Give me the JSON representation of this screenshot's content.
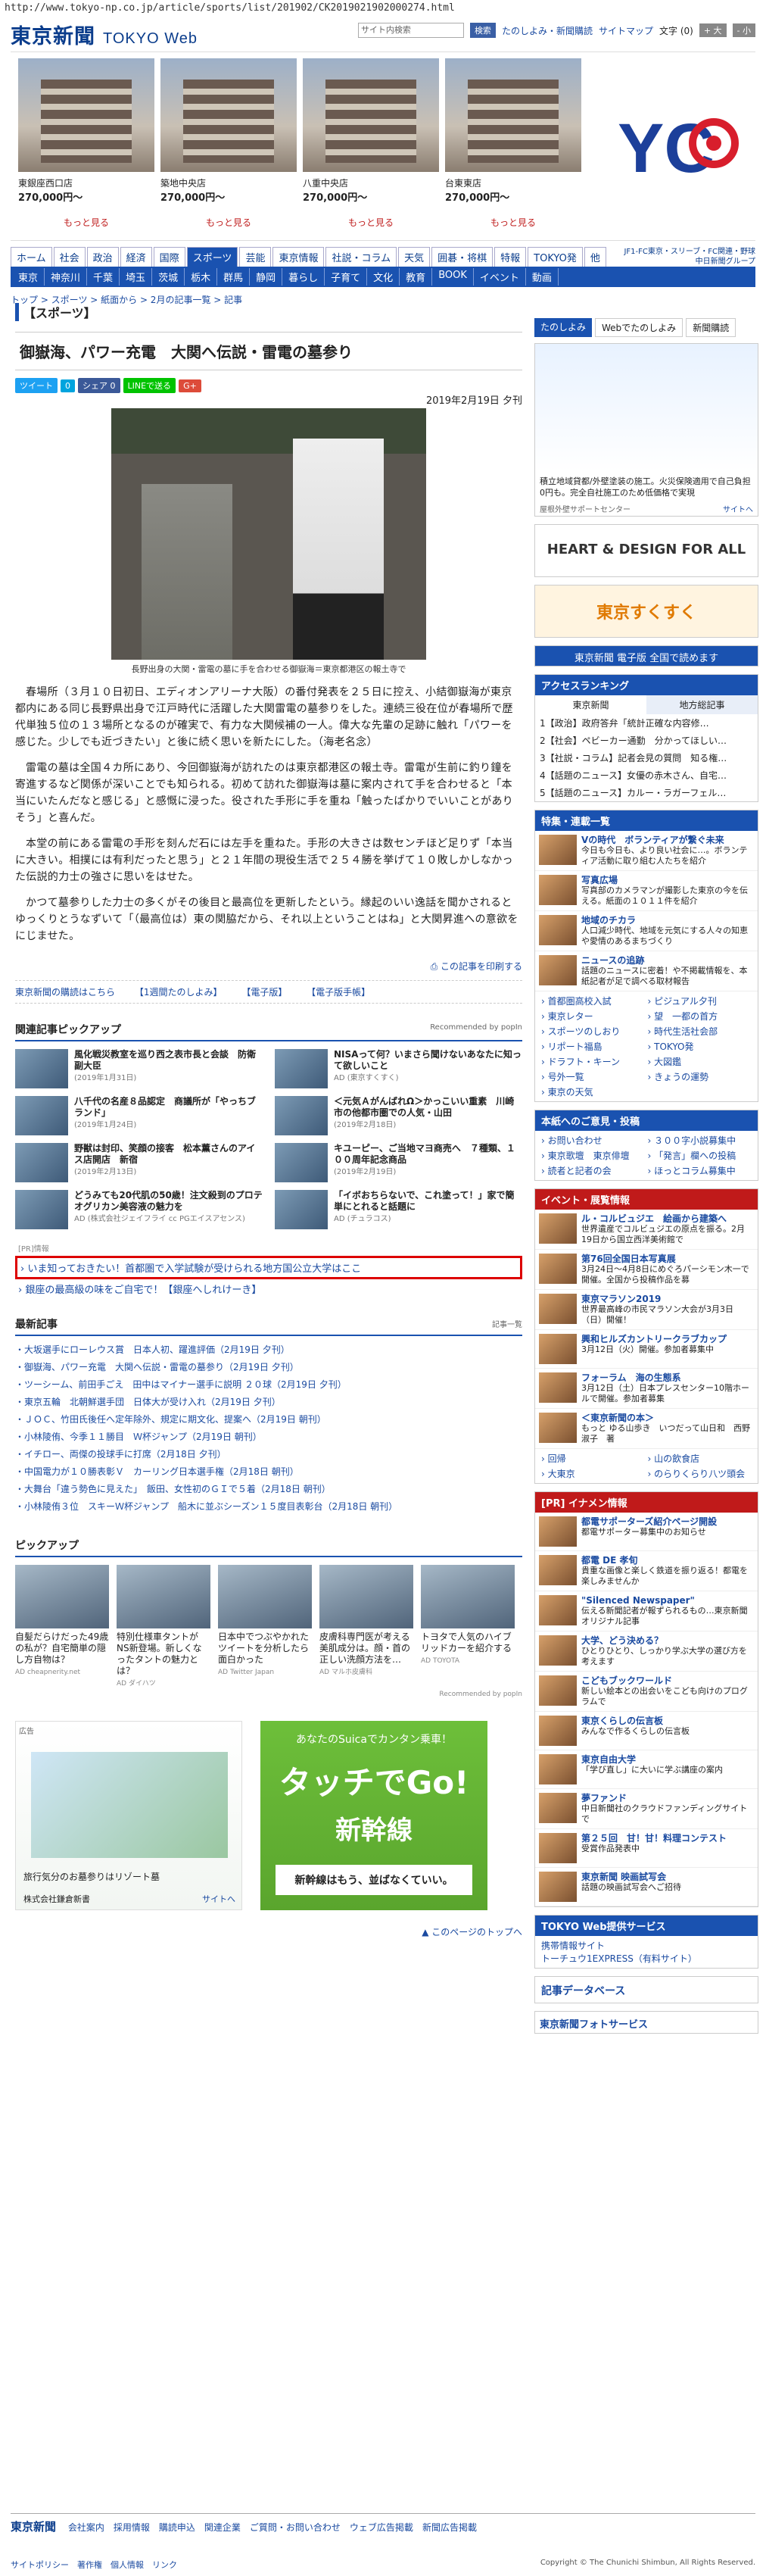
{
  "url": "http://www.tokyo-np.co.jp/article/sports/list/201902/CK2019021902000274.html",
  "logo": {
    "name": "東京新聞",
    "web": "TOKYO Web"
  },
  "header": {
    "search_placeholder": "サイト内検索",
    "search_btn": "検索",
    "links": [
      "たのしよみ・新聞購読",
      "サイトマップ"
    ],
    "font_label": "文字",
    "font_size": "(0)",
    "plus": "+ 大",
    "minus": "- 小"
  },
  "props": [
    {
      "name": "東銀座西口店",
      "price": "270,000円〜",
      "more": "もっと見る"
    },
    {
      "name": "築地中央店",
      "price": "270,000円〜",
      "more": "もっと見る"
    },
    {
      "name": "八重中央店",
      "price": "270,000円〜",
      "more": "もっと見る"
    },
    {
      "name": "台東東店",
      "price": "270,000円〜",
      "more": "もっと見る"
    }
  ],
  "ad_logo": "YC",
  "nav1": [
    "ホーム",
    "社会",
    "政治",
    "経済",
    "国際",
    "スポーツ",
    "芸能",
    "東京情報",
    "社説・コラム",
    "天気",
    "囲碁・将棋",
    "特報",
    "TOKYO発",
    "他"
  ],
  "nav2": [
    "東京",
    "神奈川",
    "千葉",
    "埼玉",
    "茨城",
    "栃木",
    "群馬",
    "静岡",
    "暮らし",
    "子育て",
    "文化",
    "教育",
    "BOOK",
    "イベント",
    "動画"
  ],
  "nav_right": [
    "JF1-FC東京・スリーブ・FC関連・野球",
    "中日新聞グループ"
  ],
  "crumb": "トップ > スポーツ > 紙面から > 2月の記事一覧 > 記事",
  "category": "【スポーツ】",
  "title": "御嶽海、パワー充電　大関へ伝説・雷電の墓参り",
  "share": [
    "ツイート",
    "0",
    "シェア 0",
    "LINEで送る",
    "G+"
  ],
  "date": "2019年2月19日 夕刊",
  "caption": "長野出身の大関・雷電の墓に手を合わせる御嶽海＝東京都港区の報土寺で",
  "paragraphs": [
    "春場所（３月１０日初日、エディオンアリーナ大阪）の番付発表を２５日に控え、小結御嶽海が東京都内にある同じ長野県出身で江戸時代に活躍した大関雷電の墓参りをした。連続三役在位が春場所で歴代単独５位の１３場所となるのが確実で、有力な大関候補の一人。偉大な先輩の足跡に触れ「パワーを感じた。少しでも近づきたい」と後に続く思いを新たにした。（海老名念）",
    "雷電の墓は全国４カ所にあり、今回御嶽海が訪れたのは東京都港区の報土寺。雷電が生前に釣り鐘を寄進するなど関係が深いことでも知られる。初めて訪れた御嶽海は墓に案内されて手を合わせると「本当にいたんだなと感じる」と感慨に浸った。役された手形に手を重ね「触ったばかりでいいことがありそう」と喜んだ。",
    "本堂の前にある雷電の手形を刻んだ石には左手を重ねた。手形の大きさは数センチほど足りず「本当に大きい。相撲には有利だったと思う」と２１年間の現役生活で２５４勝を挙げて１０敗しかしなかった伝説的力士の強さに思いをはせた。",
    "かつて墓参りした力士の多くがその後目と最高位を更新したという。縁起のいい逸話を聞かされるとゆっくりとうなずいて「（最高位は）東の関脇だから、それ以上ということはね」と大関昇進への意欲をにじませた。"
  ],
  "print": "この記事を印刷する",
  "links": [
    "東京新聞の購読はこちら",
    "【1週間たのしよみ】",
    "【電子版】",
    "【電子版手帳】"
  ],
  "related_hd": "関連記事ピックアップ",
  "related_sub": "Recommended by popIn",
  "related": [
    {
      "t": "風化戦災教室を巡り西之表市長と会談　防衛副大臣",
      "d": "(2019年1月31日)"
    },
    {
      "t": "NISAって何？いまさら聞けないあなたに知って欲しいこと",
      "d": "AD (東京すくすく)"
    },
    {
      "t": "八千代の名産８品認定　商議所が「やっちブランド」",
      "d": "(2019年1月24日)"
    },
    {
      "t": "＜元気ＡがんばれΩ＞かっこいい重素　川崎市の他都市圏での人気・山田",
      "d": "(2019年2月18日)"
    },
    {
      "t": "野獣は封印、笑顔の接客　松本薫さんのアイス店開店　新宿",
      "d": "(2019年2月13日)"
    },
    {
      "t": "キユーピー、ご当地マヨ商売へ　７種類、１００周年記念商品",
      "d": "(2019年2月19日)"
    },
    {
      "t": "どうみても20代肌の50歳！注文殺到のプロテオグリカン美容液の魅力を",
      "d": "AD (株式会社ジェイフライ cc PGエイスアセンス)"
    },
    {
      "t": "「イボおちらないで、これ塗って！」家で簡単にとれると話題に",
      "d": "AD (チュラコス)"
    }
  ],
  "pr_label": "[PR]情報",
  "pr_items": [
    "いま知っておきたい！首都圏で入学試験が受けられる地方国公立大学はここ",
    "銀座の最高級の味をご自宅で！【銀座へしれけーき】"
  ],
  "latest_hd": "最新記事",
  "latest_sub": "記事一覧",
  "latest": [
    "大坂選手にローレウス賞　日本人初、躍進評価（2月19日 夕刊）",
    "御嶽海、パワー充電　大関へ伝説・雷電の墓参り（2月19日 夕刊）",
    "ツーシーム、前田手ごえ　田中はマイナー選手に説明 ２０球（2月19日 夕刊）",
    "東京五輪　北朝鮮選手団　日体大が受け入れ（2月19日 夕刊）",
    "ＪＯＣ、竹田氏後任へ定年除外、規定に期文化、提案へ（2月19日 朝刊）",
    "小林陵侑、今季１１勝目　Ｗ杯ジャンプ（2月19日 朝刊）",
    "イチロー、両傑の投球手に打席（2月18日 夕刊）",
    "中国電力が１０勝表彰Ｖ　カーリング日本選手権（2月18日 朝刊）",
    "大舞台「違う勢色に見えた」　飯田、女性初のＧＩで５着（2月18日 朝刊）",
    "小林陵侑３位　スキーＷ杯ジャンプ　船木に並ぶシーズン１５度目表彰台（2月18日 朝刊）"
  ],
  "pickup_hd": "ピックアップ",
  "pickup": [
    {
      "t": "自髪だらけだった49歳の私が？自宅簡単の隠し方自物は？",
      "s": "AD cheapnerity.net"
    },
    {
      "t": "特別仕様車タントがNS新登場。新しくなったタントの魅力とは？",
      "s": "AD ダイハツ"
    },
    {
      "t": "日本中でつぶやかれたツイートを分析したら面白かった",
      "s": "AD Twitter Japan"
    },
    {
      "t": "皮膚科専門医が考える美肌成分は。顔・首の正しい洗顔方法を…",
      "s": "AD マルホ皮膚科"
    },
    {
      "t": "トヨタで人気のハイブリッドカーを紹介する",
      "s": "AD TOYOTA"
    }
  ],
  "pickup_sub": "Recommended by popIn",
  "ad1": {
    "label": "広告",
    "text": "旅行気分のお墓参りはリゾート墓",
    "sponsor": "株式会社鎌倉新書",
    "site": "サイトへ"
  },
  "ad2": {
    "t1": "あなたのSuicaでカンタン乗車！",
    "t2": "タッチでGo!",
    "t3": "新幹線",
    "t4": "新幹線はもう、並ばなくていい。"
  },
  "totop": "このページのトップへ",
  "side": {
    "tabs": [
      "たのしよみ",
      "Webでたのしよみ",
      "新聞購読"
    ],
    "adtxt": "積立地域貸都/外壁塗装の施工。火災保険適用で自己負担0円も。完全自社施工のため低価格で実現",
    "adsrc": "屋根外壁サポートセンター",
    "adsite": "サイトへ",
    "heart": "HEART & DESIGN FOR ALL",
    "sukusuku": "東京すくすく",
    "denshi": "東京新聞 電子版 全国で読めます",
    "ranking_hd": "アクセスランキング",
    "ranking_tabs": [
      "東京新聞",
      "地方総記事"
    ],
    "ranking": [
      "1【政治】政府答弁「統計正確な内容修…",
      "2【社会】ペビーカー通勤　分かってほしい…",
      "3【社説・コラム】記者会見の質問　知る権…",
      "4【話題のニュース】女優の赤木さん、自宅…",
      "5【話題のニュース】カルー・ラガーフェル…"
    ],
    "special_hd": "特集・連載一覧",
    "special": [
      {
        "t": "Vの時代　ボランティアが繋ぐ未来",
        "d": "今日も今日も、より良い社会に…。ボランティア活動に取り組む人たちを紹介"
      },
      {
        "t": "写真広場",
        "d": "写真部のカメラマンが撮影した東京の今を伝える。紙面の１０１１件を紹介"
      },
      {
        "t": "地域のチカラ",
        "d": "人口減少時代、地域を元気にする人々の知恵や愛情のあるまちづくり"
      },
      {
        "t": "ニュースの追跡",
        "d": "話題のニュースに密着！や不掲載情報を、本紙記者が足で調べる取材報告"
      }
    ],
    "menu": [
      "首都圏高校入試",
      "ピジュアル夕刊",
      "東京レター",
      "望　一都の首方",
      "スポーツのしおり",
      "時代生活社会部",
      "リポート福島",
      "TOKYO発",
      "ドラフト・キーン",
      "大図鑑",
      "号外一覧",
      "きょうの運勢",
      "東京の天気"
    ],
    "honsha_hd": "本紙へのご意見・投稿",
    "honsha": [
      "お問い合わせ",
      "３００字小説募集中",
      "東京歌壇　東京俳壇",
      "「発言」欄への投稿",
      "読者と記者の会",
      "ほっとコラム募集中"
    ],
    "event_hd": "イベント・展覧情報",
    "events": [
      {
        "t": "ル・コルビュジエ　絵画から建築へ",
        "d": "世界遺産でコルビュジエの原点を振る。2月19日から国立西洋美術館で"
      },
      {
        "t": "第76回全国日本写真展",
        "d": "3月24日〜4月8日にめぐろパーシモン木一で開催。全国から投稿作品を募"
      },
      {
        "t": "東京マラソン2019",
        "d": "世界最高峰の市民マラソン大会が3月3日（日）開催！"
      },
      {
        "t": "興和ヒルズカントリークラブカップ",
        "d": "3月12日（火）開催。参加者募集中"
      },
      {
        "t": "フォーラム　海の生態系",
        "d": "3月12日（土）日本プレスセンター10階ホールで開催。参加者募集"
      },
      {
        "t": "＜東京新聞の本＞",
        "d": "もっと ゆる山歩き　いつだって山日和　西野淑子　著"
      }
    ],
    "fukubox": [
      "回帰",
      "山の飲食店",
      "大東京",
      "のらりくらり八ツ頭会"
    ],
    "pr_hd": "[PR] イナメン情報",
    "pr": [
      {
        "t": "都電サポーターズ紹介ページ開設",
        "d": "都電サポーター募集中のお知らせ"
      },
      {
        "t": "都電 DE 孝旬",
        "d": "貴重な画像と楽しく鉄道を振り返る！都電を楽しみませんか"
      },
      {
        "t": "\"Silenced Newspaper\"",
        "d": "伝える新聞記者が報ずられるもの…東京新聞オリジナル記事"
      },
      {
        "t": "大学、どう決める？",
        "d": "ひとりひとり、しっかり学ぶ大学の選び方を考えます"
      },
      {
        "t": "こどもブックワールド",
        "d": "新しい絵本との出会いをこども向けのプログラムで"
      },
      {
        "t": "東京くらしの伝言板",
        "d": "みんなで作るくらしの伝言板"
      },
      {
        "t": "東京自由大学",
        "d": "「学び直し」に大いに学ぶ講座の案内"
      },
      {
        "t": "夢ファンド",
        "d": "中日新聞社のクラウドファンディングサイトで"
      },
      {
        "t": "第２５回　甘！甘！料理コンテスト",
        "d": "受賞作品発表中"
      },
      {
        "t": "東京新聞 映画試写会",
        "d": "話題の映画試写会へご招待"
      }
    ],
    "service_hd": "TOKYO Web提供サービス",
    "service": [
      "携帯情報サイト",
      "トーチュウ1EXPRESS（有料サイト）"
    ],
    "db": "記事データベース",
    "photo_service": "東京新聞フォトサービス"
  },
  "footer": [
    "会社案内",
    "採用情報",
    "購読申込",
    "関連企業",
    "ご質問・お問い合わせ",
    "ウェブ広告掲載",
    "新聞広告掲載"
  ],
  "bottom": "サイトポリシー　著作権　個人情報　リンク",
  "copyright": "Copyright © The Chunichi Shimbun, All Rights Reserved."
}
